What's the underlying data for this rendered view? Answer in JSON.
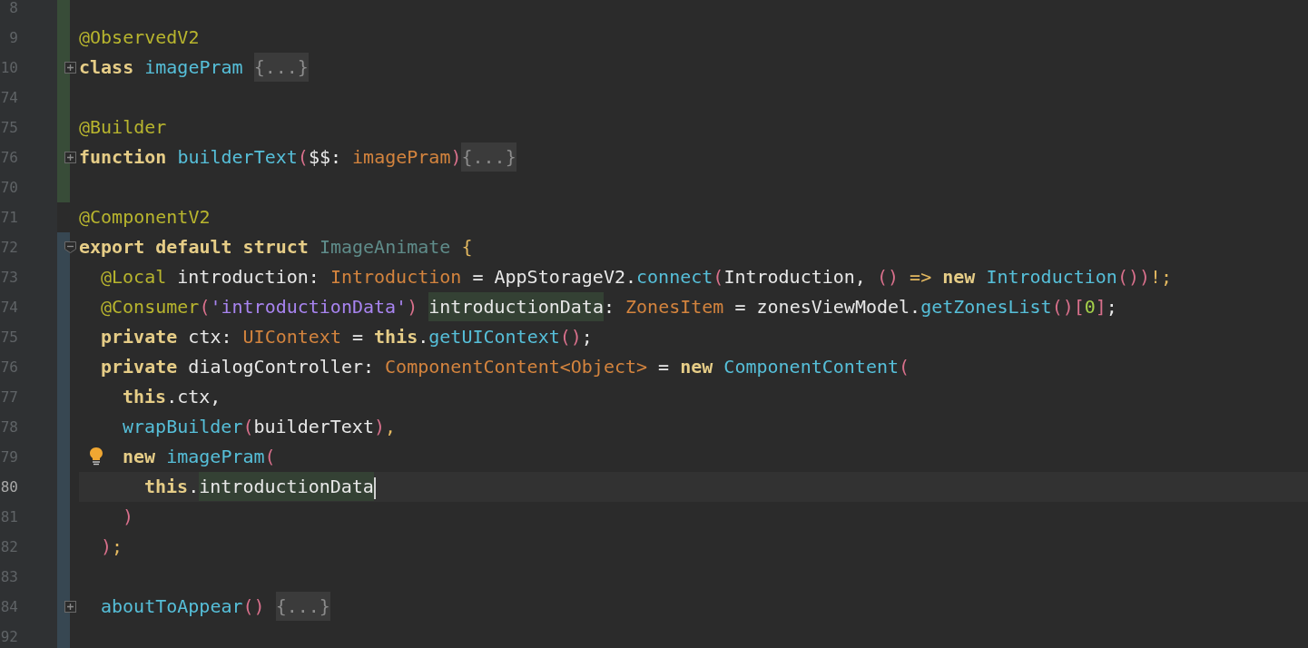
{
  "editor": {
    "lines": [
      {
        "number": "8",
        "color": "#384c38"
      },
      {
        "number": "9",
        "color": "#384c38",
        "tokens": [
          {
            "text": "@ObservedV2",
            "kind": "annotation"
          }
        ]
      },
      {
        "number": "10",
        "color": "#384c38",
        "folded": true,
        "tokens": [
          {
            "text": "class ",
            "kind": "keyword"
          },
          {
            "text": "imagePram ",
            "kind": "function"
          },
          {
            "text": "{...}",
            "kind": "folded"
          }
        ]
      },
      {
        "number": "74",
        "color": "#384c38"
      },
      {
        "number": "75",
        "color": "#384c38",
        "tokens": [
          {
            "text": "@Builder",
            "kind": "annotation"
          }
        ]
      },
      {
        "number": "76",
        "color": "#384c38",
        "folded": true,
        "tokens": [
          {
            "text": "function ",
            "kind": "keyword"
          },
          {
            "text": "builderText",
            "kind": "function"
          },
          {
            "text": "(",
            "kind": "paren"
          },
          {
            "text": "$$: ",
            "kind": "plain"
          },
          {
            "text": "imagePram",
            "kind": "type"
          },
          {
            "text": ")",
            "kind": "paren"
          },
          {
            "text": "{...}",
            "kind": "folded"
          }
        ]
      },
      {
        "number": "70",
        "color": "#384c38"
      },
      {
        "number": "71",
        "tokens": [
          {
            "text": "@ComponentV2",
            "kind": "annotation"
          }
        ]
      },
      {
        "number": "72",
        "color": "#374752",
        "folded": false,
        "tokens": [
          {
            "text": "export default struct ",
            "kind": "keyword"
          },
          {
            "text": "ImageAnimate ",
            "kind": "classname"
          },
          {
            "text": "{",
            "kind": "brace"
          }
        ],
        "children": [
          {
            "number": "73",
            "color": "#374752",
            "tokens": [
              {
                "text": "@Local",
                "kind": "annotation"
              },
              {
                "text": " introduction: ",
                "kind": "plain"
              },
              {
                "text": "Introduction",
                "kind": "type"
              },
              {
                "text": " = AppStorageV2.",
                "kind": "plain"
              },
              {
                "text": "connect",
                "kind": "function"
              },
              {
                "text": "(",
                "kind": "paren"
              },
              {
                "text": "Introduction, ",
                "kind": "plain"
              },
              {
                "text": "()",
                "kind": "paren"
              },
              {
                "text": " => ",
                "kind": "brace"
              },
              {
                "text": "new ",
                "kind": "keyword"
              },
              {
                "text": "Introduction",
                "kind": "function"
              },
              {
                "text": "())",
                "kind": "paren"
              },
              {
                "text": "!;",
                "kind": "brace"
              }
            ]
          },
          {
            "number": "74",
            "color": "#374752",
            "tokens": [
              {
                "text": "@Consumer",
                "kind": "annotation"
              },
              {
                "text": "(",
                "kind": "paren"
              },
              {
                "text": "'introductionData'",
                "kind": "string"
              },
              {
                "text": ") ",
                "kind": "paren"
              },
              {
                "text": "introductionData",
                "kind": "highlight"
              },
              {
                "text": ": ",
                "kind": "plain"
              },
              {
                "text": "ZonesItem",
                "kind": "type"
              },
              {
                "text": " = zonesViewModel.",
                "kind": "plain"
              },
              {
                "text": "getZonesList",
                "kind": "function"
              },
              {
                "text": "()[",
                "kind": "paren"
              },
              {
                "text": "0",
                "kind": "number"
              },
              {
                "text": "]",
                "kind": "paren"
              },
              {
                "text": ";",
                "kind": "plain"
              }
            ]
          },
          {
            "number": "75",
            "color": "#374752",
            "tokens": [
              {
                "text": "private",
                "kind": "keyword"
              },
              {
                "text": " ctx: ",
                "kind": "plain"
              },
              {
                "text": "UIContext",
                "kind": "type"
              },
              {
                "text": " = ",
                "kind": "plain"
              },
              {
                "text": "this",
                "kind": "keyword"
              },
              {
                "text": ".",
                "kind": "plain"
              },
              {
                "text": "getUIContext",
                "kind": "function"
              },
              {
                "text": "()",
                "kind": "paren"
              },
              {
                "text": ";",
                "kind": "plain"
              }
            ]
          },
          {
            "number": "76",
            "color": "#374752",
            "tokens": [
              {
                "text": "private",
                "kind": "keyword"
              },
              {
                "text": " dialogController: ",
                "kind": "plain"
              },
              {
                "text": "ComponentContent<Object>",
                "kind": "type"
              },
              {
                "text": " = ",
                "kind": "plain"
              },
              {
                "text": "new ",
                "kind": "keyword"
              },
              {
                "text": "ComponentContent",
                "kind": "function"
              },
              {
                "text": "(",
                "kind": "paren"
              }
            ],
            "children": [
              {
                "number": "77",
                "color": "#374752",
                "tokens": [
                  {
                    "text": "this",
                    "kind": "keyword"
                  },
                  {
                    "text": ".ctx,",
                    "kind": "plain"
                  }
                ]
              },
              {
                "number": "78",
                "color": "#374752",
                "tokens": [
                  {
                    "text": "wrapBuilder",
                    "kind": "function"
                  },
                  {
                    "text": "(",
                    "kind": "paren"
                  },
                  {
                    "text": "builderText",
                    "kind": "plain"
                  },
                  {
                    "text": ")",
                    "kind": "paren"
                  },
                  {
                    "text": ",",
                    "kind": "brace"
                  }
                ]
              },
              {
                "number": "79",
                "color": "#374752",
                "hint": true,
                "tokens": [
                  {
                    "text": "new ",
                    "kind": "keyword"
                  },
                  {
                    "text": "imagePram",
                    "kind": "function"
                  },
                  {
                    "text": "(",
                    "kind": "paren"
                  }
                ],
                "children": [
                  {
                    "number": "80",
                    "color": "#374752",
                    "current": true,
                    "tokens": [
                      {
                        "text": "this",
                        "kind": "keyword"
                      },
                      {
                        "text": ".",
                        "kind": "plain"
                      },
                      {
                        "text": "introductionData",
                        "kind": "highlight"
                      }
                    ]
                  }
                ]
              },
              {
                "number": "81",
                "color": "#374752",
                "tokens": [
                  {
                    "text": ")",
                    "kind": "paren"
                  }
                ]
              }
            ]
          },
          {
            "number": "82",
            "color": "#374752",
            "tokens": [
              {
                "text": ")",
                "kind": "paren"
              },
              {
                "text": ";",
                "kind": "brace"
              }
            ]
          },
          {
            "number": "83",
            "color": "#374752"
          },
          {
            "number": "84",
            "color": "#374752",
            "folded": true,
            "tokens": [
              {
                "text": "aboutToAppear",
                "kind": "function"
              },
              {
                "text": "() ",
                "kind": "paren"
              },
              {
                "text": "{...}",
                "kind": "folded"
              }
            ]
          },
          {
            "number": "92",
            "color": "#374752"
          }
        ]
      }
    ]
  }
}
